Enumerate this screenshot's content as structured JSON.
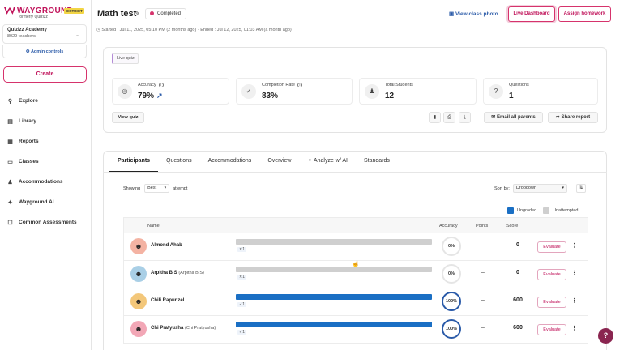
{
  "brand": {
    "name": "WAYGROUND",
    "formerly": "formerly Quizizz",
    "badge": "DISTRICT"
  },
  "org": {
    "name": "Quizizz Academy",
    "teachers": "8029 teachers",
    "admin_controls": "Admin controls"
  },
  "sidebar": {
    "create_label": "Create",
    "items": [
      {
        "label": "Explore",
        "icon": "explore-icon"
      },
      {
        "label": "Library",
        "icon": "library-icon"
      },
      {
        "label": "Reports",
        "icon": "reports-icon"
      },
      {
        "label": "Classes",
        "icon": "classes-icon"
      },
      {
        "label": "Accommodations",
        "icon": "accommodations-icon"
      },
      {
        "label": "Wayground AI",
        "icon": "ai-icon"
      },
      {
        "label": "Common Assessments",
        "icon": "assessments-icon"
      }
    ]
  },
  "header": {
    "title": "Math test",
    "status": "Completed",
    "dates": "Started : Jul 11, 2025, 05:10 PM (2 months ago) · Ended : Jul 12, 2025, 01:03 AM (a month ago)",
    "view_class_photo": "View class photo",
    "live_dashboard": "Live Dashboard",
    "assign_homework": "Assign homework"
  },
  "quiz_card": {
    "tag": "Live quiz",
    "stats": [
      {
        "label": "Accuracy",
        "value": "79%"
      },
      {
        "label": "Completion Rate",
        "value": "83%"
      },
      {
        "label": "Total Students",
        "value": "12"
      },
      {
        "label": "Questions",
        "value": "1"
      }
    ],
    "view_quiz": "View quiz",
    "email_parents": "Email all parents",
    "share_report": "Share report"
  },
  "tabs": [
    "Participants",
    "Questions",
    "Accommodations",
    "Overview",
    "Analyze w/ AI",
    "Standards"
  ],
  "filters": {
    "showing_label": "Showing",
    "attempt_value": "Best",
    "attempt_label": "attempt",
    "sort_label": "Sort by:",
    "sort_value": "Dropdown"
  },
  "legend": {
    "ungraded": "Ungraded",
    "unattempted": "Unattempted",
    "ungraded_color": "#1a6fc4",
    "unattempted_color": "#cfcfcf"
  },
  "table": {
    "headers": {
      "name": "Name",
      "accuracy": "Accuracy",
      "points": "Points",
      "score": "Score"
    },
    "evaluate_label": "Evaluate",
    "rows": [
      {
        "name": "Almond Ahab",
        "alias": "",
        "count": "1",
        "accuracy": "0%",
        "points": "–",
        "score": "0",
        "state": "unattempted"
      },
      {
        "name": "Arpitha B S",
        "alias": "(Arpitha B S)",
        "count": "1",
        "accuracy": "0%",
        "points": "–",
        "score": "0",
        "state": "unattempted"
      },
      {
        "name": "Chili Rapunzel",
        "alias": "",
        "count": "1",
        "accuracy": "100%",
        "points": "–",
        "score": "600",
        "state": "ungraded"
      },
      {
        "name": "Chi Pratyusha",
        "alias": "(Chi Pratyusha)",
        "count": "1",
        "accuracy": "100%",
        "points": "–",
        "score": "600",
        "state": "ungraded"
      }
    ]
  }
}
